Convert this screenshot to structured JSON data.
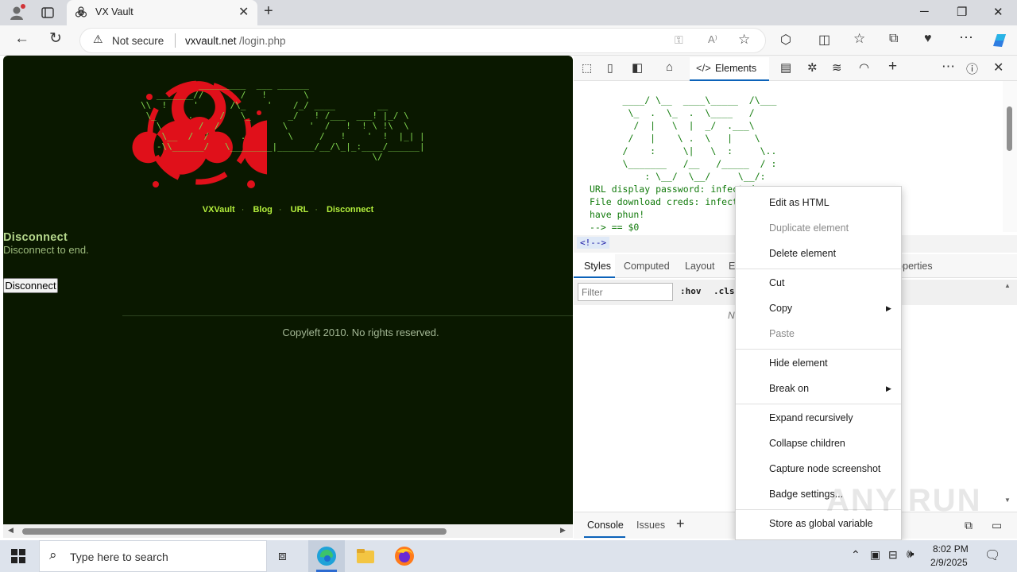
{
  "browser": {
    "tab_title": "VX Vault",
    "security_label": "Not secure",
    "url_host": "vxvault.net",
    "url_path": "/login.php"
  },
  "page": {
    "ascii_art": "                   _________  ___ ______\n           _______//       /   !       \\\n        \\\\  !     '      /\\_    '    /_/ ____        __\n         \\_      .     /   \\_       _/   ! /___  ___! |_/ \\\n           \\       /  /            \\    '  /   !  ! \\ !\\  \\\n            \\__  /  /      .        \\     /   !    '  !  |_| |\n           -\\\\______/   \\________|_______/__/\\_|_:____/______|\n                                                    \\/",
    "nav": [
      "VXVault",
      "Blog",
      "URL",
      "Disconnect"
    ],
    "heading": "Disconnect",
    "text": "Disconnect to end.",
    "button": "Disconnect",
    "footer": "Copyleft 2010. No rights reserved."
  },
  "devtools": {
    "elements_tab": "Elements",
    "dom_lines": [
      "      ____/ \\__  ____\\_____  /\\___",
      "       \\_  .  \\_  .  \\____   /",
      "        /  |   \\  |  _/  .___\\",
      "       /   |    \\ .  \\   |    \\",
      "      /    :     \\|   \\  :     \\..",
      "      \\_______   /__   /_____  / :",
      "          : \\__/  \\__/     \\__/:",
      "",
      "URL display password: infected",
      "File download creds: infected",
      "",
      "have phun!",
      "--> == $0"
    ],
    "breadcrumb": "<!-->",
    "subtabs": [
      "Styles",
      "Computed",
      "Layout",
      "E",
      "roperties"
    ],
    "filter_placeholder": "Filter",
    "hov": ":hov",
    "cls": ".cls",
    "styles_hint": "N",
    "console_tab": "Console",
    "issues_tab": "Issues"
  },
  "context_menu": [
    {
      "label": "Edit as HTML",
      "disabled": false
    },
    {
      "label": "Duplicate element",
      "disabled": true
    },
    {
      "label": "Delete element",
      "disabled": false
    },
    {
      "label": "Cut",
      "disabled": false
    },
    {
      "label": "Copy",
      "disabled": false
    },
    {
      "label": "Paste",
      "disabled": true
    },
    {
      "label": "Hide element",
      "disabled": false
    },
    {
      "label": "Break on",
      "disabled": false
    },
    {
      "label": "Expand recursively",
      "disabled": false
    },
    {
      "label": "Collapse children",
      "disabled": false
    },
    {
      "label": "Capture node screenshot",
      "disabled": false
    },
    {
      "label": "Badge settings...",
      "disabled": false
    },
    {
      "label": "Store as global variable",
      "disabled": false
    }
  ],
  "taskbar": {
    "search_placeholder": "Type here to search",
    "time": "8:02 PM",
    "date": "2/9/2025"
  },
  "watermark": "ANY RUN"
}
